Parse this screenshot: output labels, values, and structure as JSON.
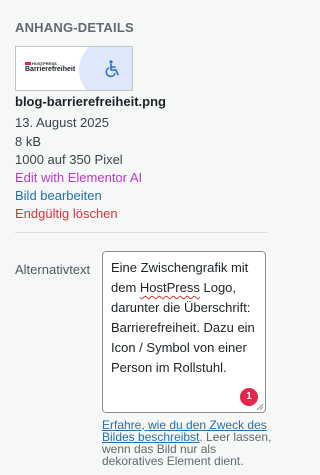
{
  "section": {
    "heading": "ANHANG-DETAILS"
  },
  "thumbnail": {
    "brand": "HOSTPRESS",
    "title": "Barrierefreiheit",
    "icon": "wheelchair-icon"
  },
  "attachment": {
    "filename": "blog-barrierefreiheit.png",
    "date": "13. August 2025",
    "filesize": "8 kB",
    "dimensions": "1000 auf 350 Pixel"
  },
  "actions": {
    "elementor": "Edit with Elementor AI",
    "edit": "Bild bearbeiten",
    "delete": "Endgültig löschen"
  },
  "alt": {
    "label": "Alternativtext",
    "text_before": "Eine Zwischengrafik mit dem ",
    "spell_word": "HostPress",
    "text_after": " Logo, darunter die Überschrift: Barrierefreiheit. Dazu ein Icon / Symbol von einer Person im Rollstuhl.",
    "badge": "1"
  },
  "help": {
    "link": "Erfahre, wie du den Zweck des Bildes beschreibst",
    "text": ". Leer lassen, wenn das Bild nur als dekoratives Element dient."
  },
  "colors": {
    "link": "#2271b1",
    "elementor": "#c036d6",
    "delete": "#d63638",
    "badge": "#e2264d"
  }
}
